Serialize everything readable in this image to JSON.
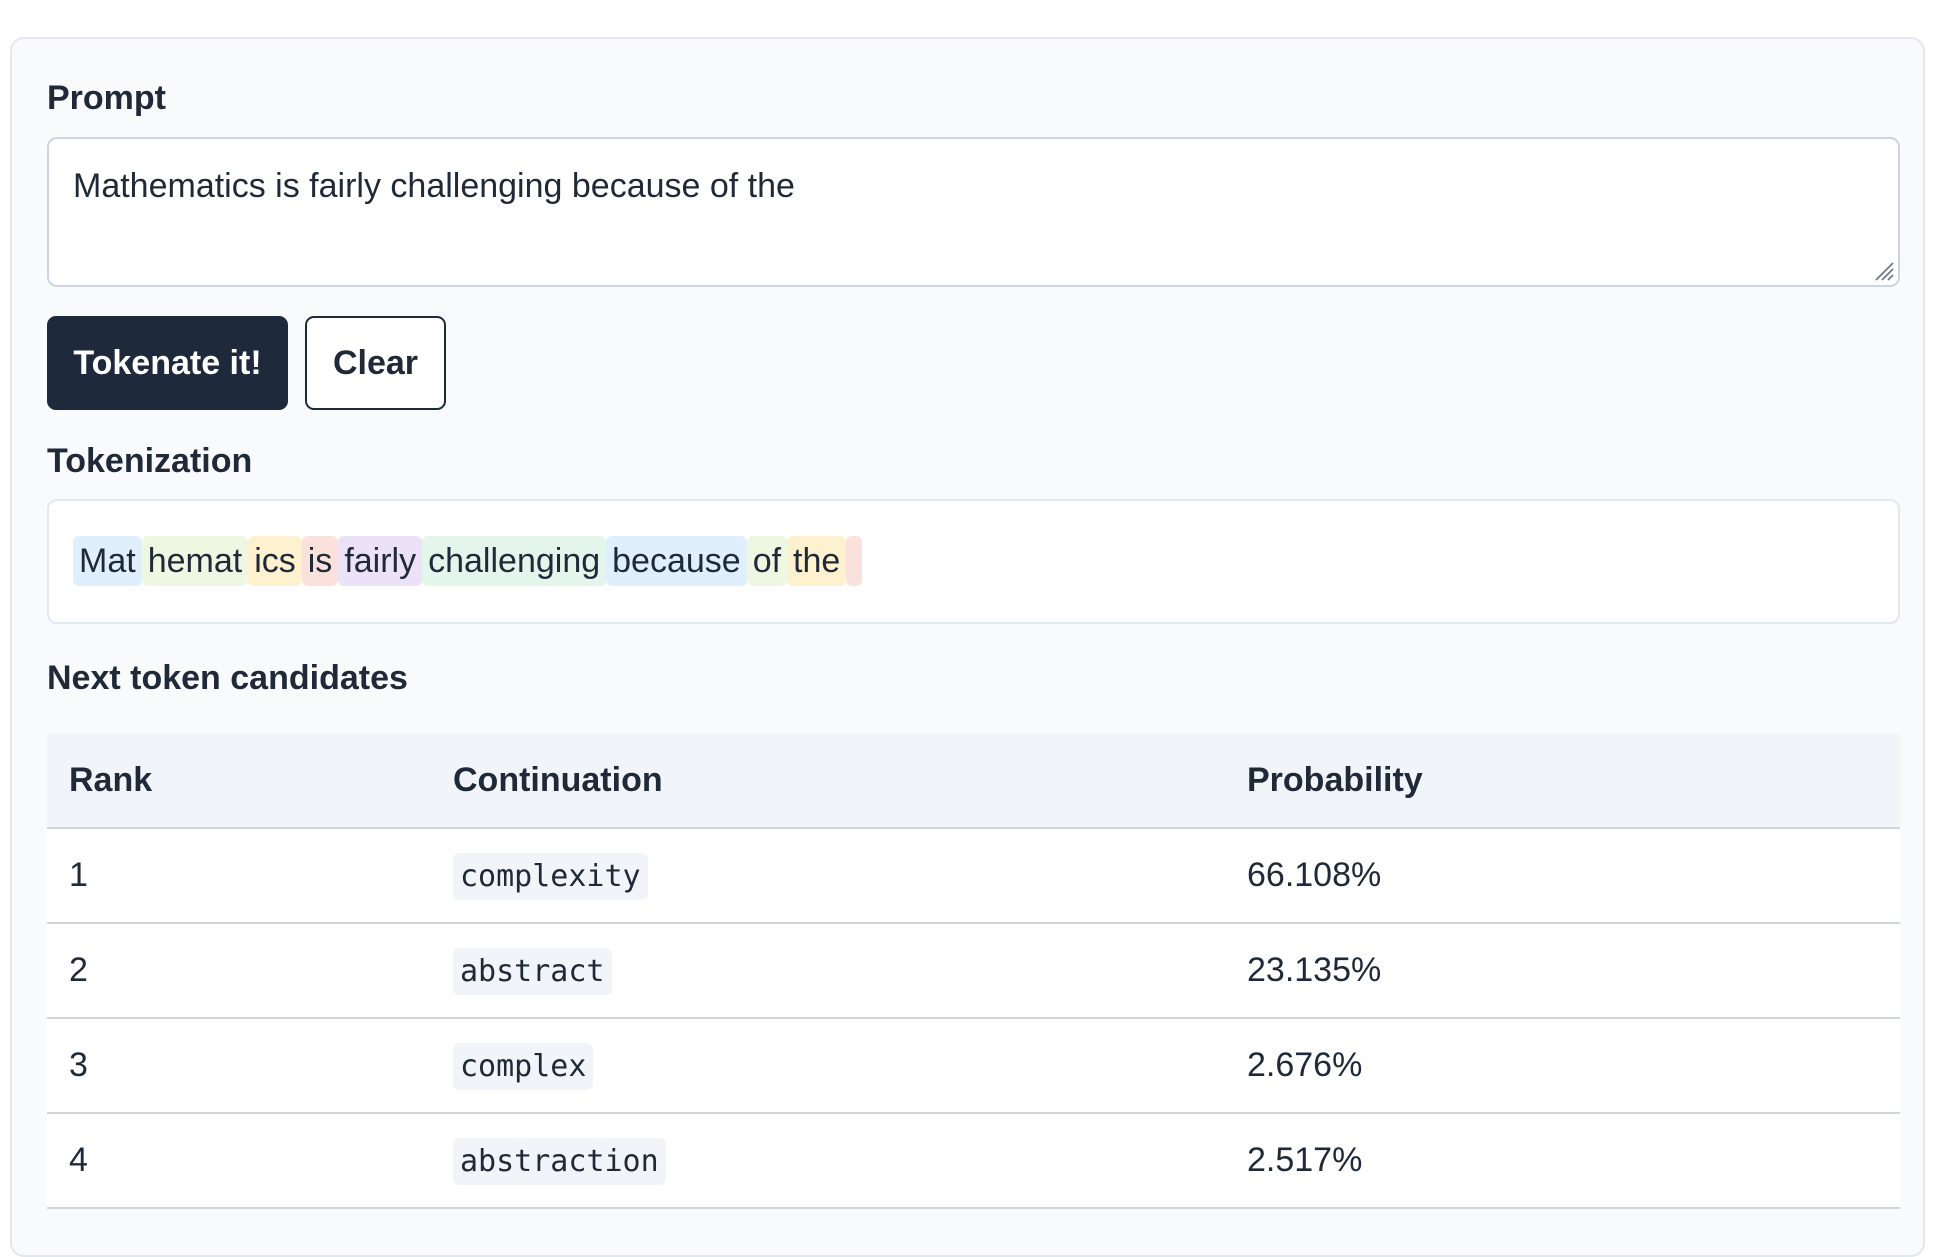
{
  "prompt": {
    "label": "Prompt",
    "value": "Mathematics is fairly challenging because of the"
  },
  "buttons": {
    "tokenate_label": "Tokenate it!",
    "clear_label": "Clear"
  },
  "tokenization": {
    "label": "Tokenization",
    "tokens": [
      {
        "text": "Mat",
        "color": "#e0effc"
      },
      {
        "text": "hemat",
        "color": "#eef7e2"
      },
      {
        "text": "ics",
        "color": "#fdf1cf"
      },
      {
        "text": "is",
        "color": "#fbe1dc"
      },
      {
        "text": "fairly",
        "color": "#ebe2f8"
      },
      {
        "text": "challenging",
        "color": "#e4f5ec"
      },
      {
        "text": "because",
        "color": "#e0effc"
      },
      {
        "text": "of",
        "color": "#eef7e2"
      },
      {
        "text": "the",
        "color": "#fdf1cf"
      },
      {
        "text": " ",
        "color": "#fbe1dc"
      }
    ]
  },
  "candidates": {
    "label": "Next token candidates",
    "headers": {
      "rank": "Rank",
      "continuation": "Continuation",
      "probability": "Probability"
    },
    "rows": [
      {
        "rank": "1",
        "continuation": "complexity",
        "probability": "66.108%"
      },
      {
        "rank": "2",
        "continuation": "abstract",
        "probability": "23.135%"
      },
      {
        "rank": "3",
        "continuation": "complex",
        "probability": "2.676%"
      },
      {
        "rank": "4",
        "continuation": "abstraction",
        "probability": "2.517%"
      }
    ]
  }
}
